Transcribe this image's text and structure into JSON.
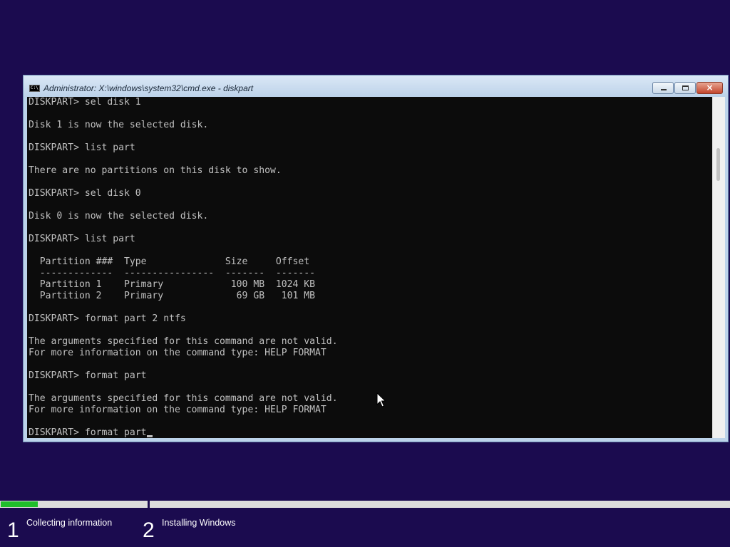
{
  "window": {
    "title": "Administrator: X:\\windows\\system32\\cmd.exe - diskpart",
    "icon_label": "C:\\",
    "minimize_icon": "minimize-icon",
    "maximize_icon": "maximize-icon",
    "close_glyph": "×"
  },
  "console": {
    "text": "DISKPART> sel disk 1\n\nDisk 1 is now the selected disk.\n\nDISKPART> list part\n\nThere are no partitions on this disk to show.\n\nDISKPART> sel disk 0\n\nDisk 0 is now the selected disk.\n\nDISKPART> list part\n\n  Partition ###  Type              Size     Offset\n  -------------  ----------------  -------  -------\n  Partition 1    Primary            100 MB  1024 KB\n  Partition 2    Primary             69 GB   101 MB\n\nDISKPART> format part 2 ntfs\n\nThe arguments specified for this command are not valid.\nFor more information on the command type: HELP FORMAT\n\nDISKPART> format part\n\nThe arguments specified for this command are not valid.\nFor more information on the command type: HELP FORMAT\n\nDISKPART> format part",
    "text_color": "#c0c0c0",
    "background": "#0c0c0c"
  },
  "setup": {
    "steps": [
      {
        "number": "1",
        "label": "Collecting information"
      },
      {
        "number": "2",
        "label": "Installing Windows"
      }
    ],
    "progress_color": "#1fbf2b",
    "background_color": "#1b0b4f"
  }
}
